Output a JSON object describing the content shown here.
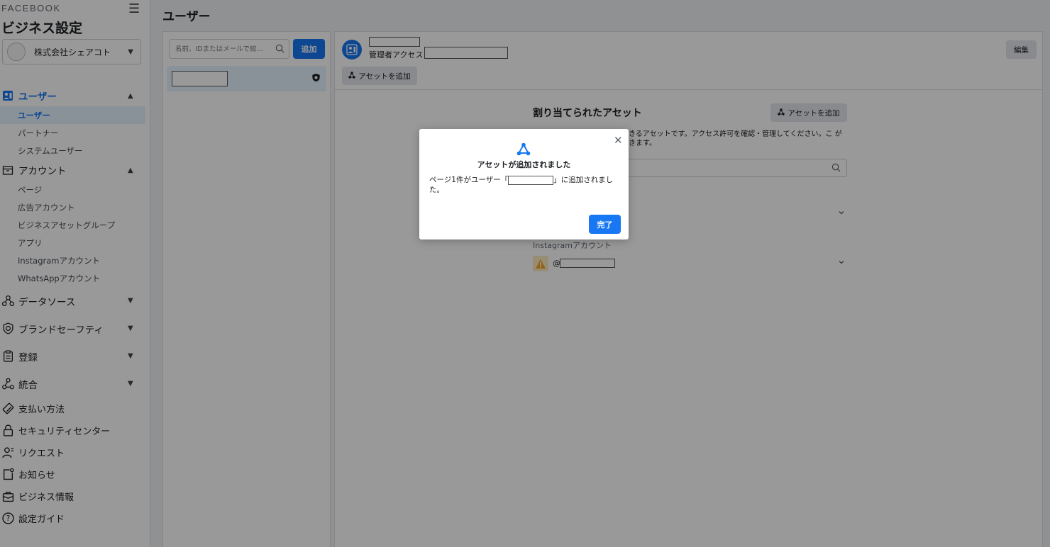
{
  "sidebar": {
    "brand": "FACEBOOK",
    "title": "ビジネス設定",
    "business_name": "株式会社シェアコト",
    "sections": {
      "users": {
        "label": "ユーザー",
        "items": [
          "ユーザー",
          "パートナー",
          "システムユーザー"
        ]
      },
      "accounts": {
        "label": "アカウント",
        "items": [
          "ページ",
          "広告アカウント",
          "ビジネスアセットグループ",
          "アプリ",
          "Instagramアカウント",
          "WhatsAppアカウント"
        ]
      },
      "data_sources": {
        "label": "データソース"
      },
      "brand_safety": {
        "label": "ブランドセーフティ"
      },
      "registrations": {
        "label": "登録"
      },
      "integrations": {
        "label": "統合"
      }
    },
    "plain_items": [
      "支払い方法",
      "セキュリティセンター",
      "リクエスト",
      "お知らせ",
      "ビジネス情報",
      "設定ガイド"
    ]
  },
  "page_title": "ユーザー",
  "list": {
    "search_placeholder": "名前、IDまたはメールで絞...",
    "add_label": "追加"
  },
  "detail": {
    "access_label": "管理者アクセス",
    "edit_label": "編集",
    "add_assets_label": "アセットを追加",
    "assets_title": "割り当てられたアセット",
    "assets_add_label": "アセットを追加",
    "assets_desc": "できるアセットです。アクセス許可を確認・管理してください。こ ができます。",
    "ig_label": "Instagramアカウント",
    "ig_handle_prefix": "@"
  },
  "modal": {
    "title": "アセットが追加されました",
    "body_before": "ページ1件がユーザー「",
    "body_after": "」に追加されました。",
    "done_label": "完了"
  },
  "colors": {
    "accent": "#1877f2",
    "warning": "#f5a623"
  }
}
